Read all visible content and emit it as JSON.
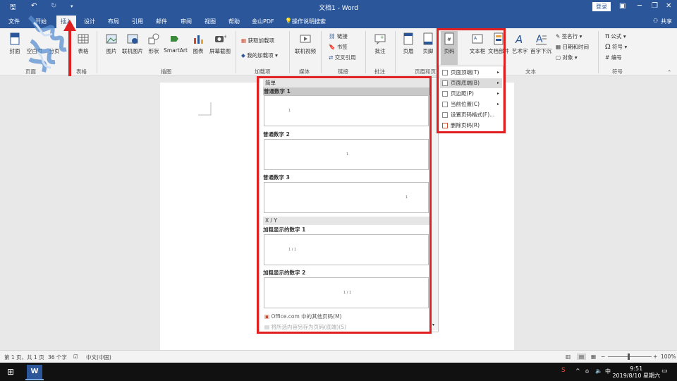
{
  "window": {
    "title": "文档1 - Word",
    "login_label": "登录",
    "share_label": "共享"
  },
  "tabs": [
    "文件",
    "开始",
    "插入",
    "设计",
    "布局",
    "引用",
    "邮件",
    "审阅",
    "视图",
    "帮助",
    "金山PDF"
  ],
  "tell_me": "操作说明搜索",
  "ribbon": {
    "buttons": {
      "cover": "封面",
      "blank_page": "空白页",
      "page_break": "分页",
      "table": "表格",
      "picture": "图片",
      "online_picture": "联机图片",
      "shapes": "形状",
      "smartart": "SmartArt",
      "chart": "图表",
      "screenshot": "屏幕截图",
      "get_addins": "获取加载项",
      "my_addins": "我的加载项",
      "online_video": "联机视频",
      "link": "链接",
      "bookmark": "书签",
      "cross_ref": "交叉引用",
      "comment": "批注",
      "header": "页眉",
      "footer": "页脚",
      "page_number": "页码",
      "text_box": "文本框",
      "quick_parts": "文档部件",
      "wordart": "艺术字",
      "drop_cap": "首字下沉",
      "signature_line": "签名行",
      "date_time": "日期和时间",
      "object": "对象",
      "equation": "公式",
      "symbol": "符号",
      "number": "编号"
    },
    "groups": {
      "pages": "页面",
      "tables": "表格",
      "illustrations": "插图",
      "addins": "加载项",
      "media": "媒体",
      "links": "链接",
      "comments": "批注",
      "header_footer": "页眉和页",
      "text": "文本",
      "symbols": "符号"
    }
  },
  "page_number_menu": {
    "items": [
      {
        "label": "页面顶端(T)",
        "submenu": true
      },
      {
        "label": "页面底端(B)",
        "submenu": true,
        "highlighted": true
      },
      {
        "label": "页边距(P)",
        "submenu": true
      },
      {
        "label": "当前位置(C)",
        "submenu": true
      },
      {
        "label": "设置页码格式(F)...",
        "submenu": false
      },
      {
        "label": "删除页码(R)",
        "submenu": false
      }
    ]
  },
  "gallery": {
    "section_simple": "简单",
    "items_simple": [
      {
        "label": "普通数字 1",
        "sample": "1"
      },
      {
        "label": "普通数字 2",
        "sample": "1"
      },
      {
        "label": "普通数字 3",
        "sample": "1"
      }
    ],
    "section_xy": "X / Y",
    "items_xy": [
      {
        "label": "加粗显示的数字 1",
        "sample": "1 / 1"
      },
      {
        "label": "加粗显示的数字 2",
        "sample": "1 / 1"
      }
    ],
    "footer_more": "Office.com 中的其他页码(M)",
    "footer_save": "将所选内容另存为页码(底端)(S)"
  },
  "status": {
    "pages": "第 1 页，共 1 页",
    "words": "36 个字",
    "language": "中文(中国)",
    "zoom": "100%"
  },
  "clock": {
    "time": "9:51",
    "date": "2019/8/10 星期六"
  },
  "colors": {
    "word_blue": "#2b579a",
    "highlight_red": "#e02020"
  }
}
